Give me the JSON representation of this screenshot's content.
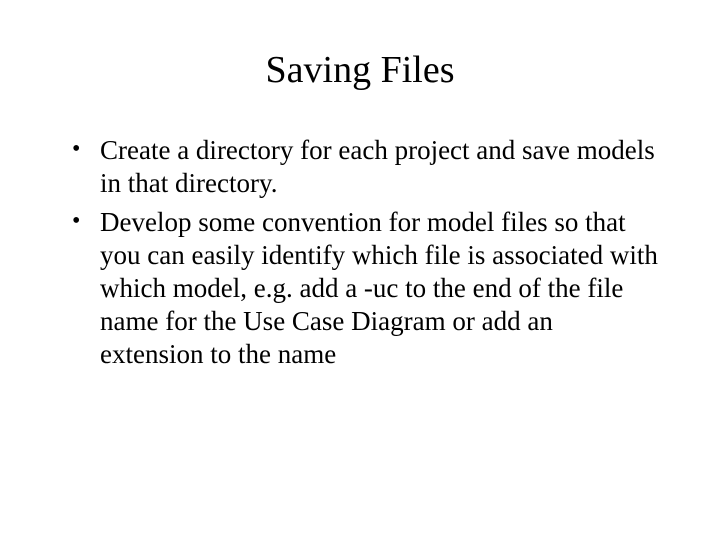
{
  "title": "Saving Files",
  "bullets": [
    "Create a directory for each project and save models in that directory.",
    "Develop some convention for model files so that you can easily identify which file is associated with which model, e.g. add a -uc to the end of the file name for the Use Case Diagram or add an extension to the name"
  ]
}
